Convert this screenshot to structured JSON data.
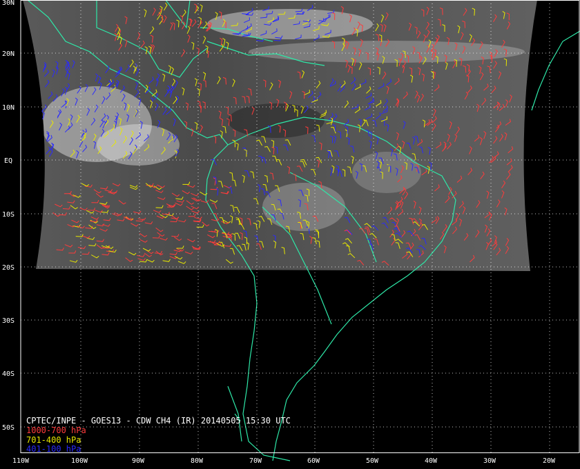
{
  "title": "CPTEC/INPE - GOES13 - CDW CH4 (IR) 20140505 15:30 UTC",
  "legend": [
    {
      "label": "1000-700 hPa",
      "color": "#ff3b3b"
    },
    {
      "label": "701-400 hPa",
      "color": "#e8e800"
    },
    {
      "label": "401-100 hPa",
      "color": "#2a2aff"
    }
  ],
  "lat_labels": [
    "30N",
    "20N",
    "10N",
    "EQ",
    "10S",
    "20S",
    "30S",
    "40S",
    "50S"
  ],
  "lon_labels": [
    "110W",
    "100W",
    "90W",
    "80W",
    "70W",
    "60W",
    "50W",
    "40W",
    "30W",
    "20W"
  ],
  "colors": {
    "background": "#000000",
    "coast": "#2ee8a8",
    "grid": "#ffffff",
    "frame": "#ffffff"
  }
}
